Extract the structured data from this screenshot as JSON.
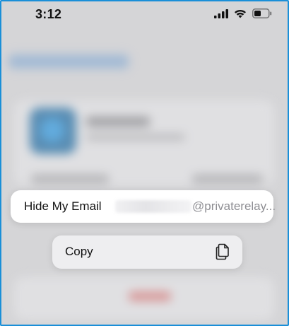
{
  "status_bar": {
    "time": "3:12",
    "icons": [
      "cellular-signal-icon",
      "wifi-icon",
      "battery-icon"
    ]
  },
  "context_item": {
    "label": "Hide My Email",
    "value": "@privaterelay...",
    "value_redacted": true
  },
  "menu": {
    "items": [
      {
        "label": "Copy",
        "icon": "copy-icon"
      }
    ]
  },
  "colors": {
    "screen_border": "#1a8fd8",
    "value_text": "#8e8e93"
  }
}
